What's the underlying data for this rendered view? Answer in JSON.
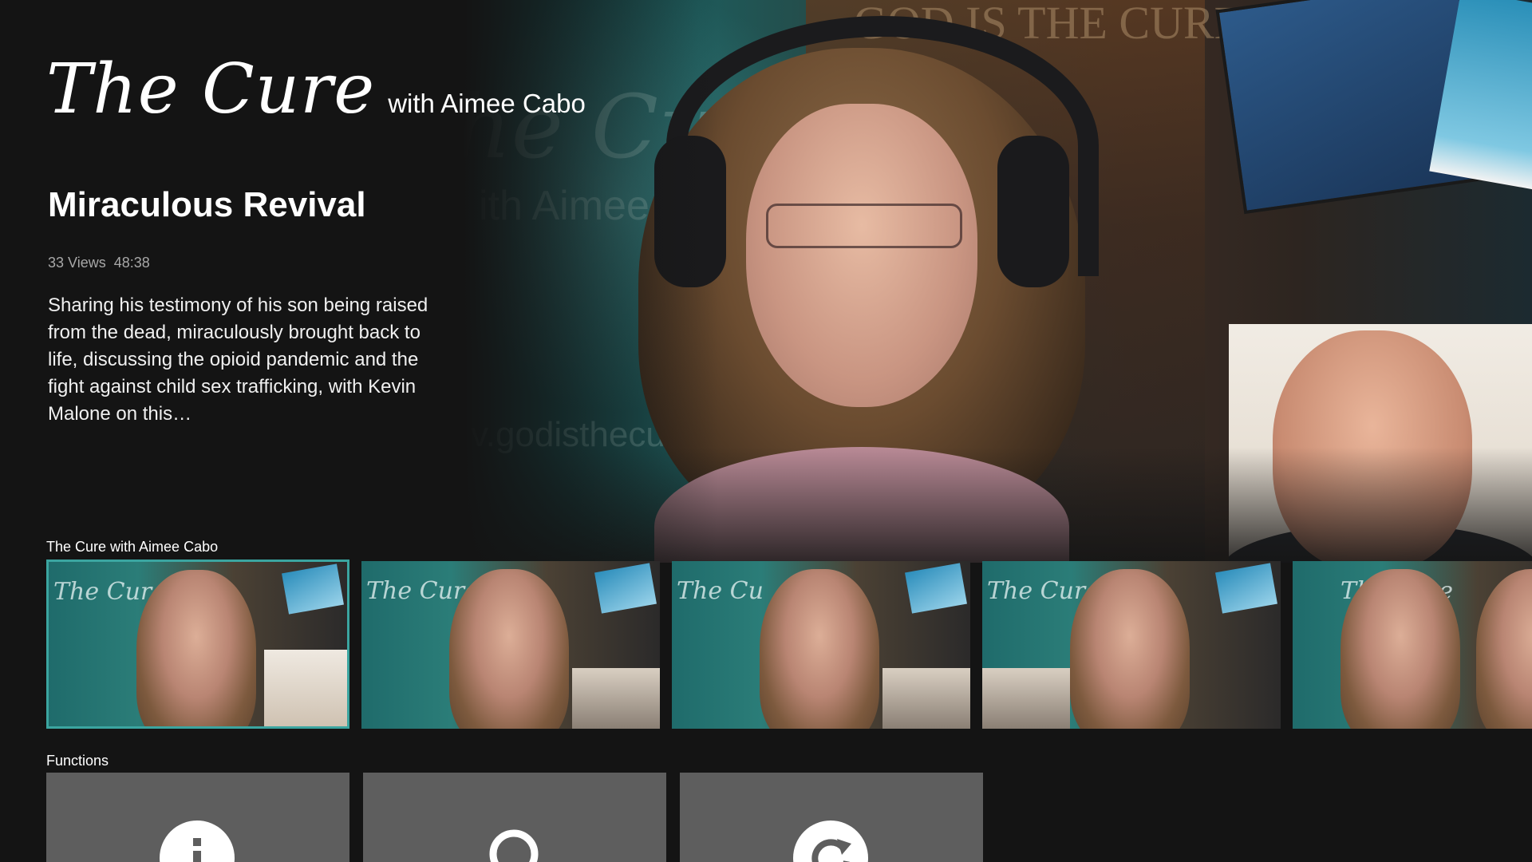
{
  "hero": {
    "logo_main": "The Cure",
    "logo_sub": "with Aimee Cabo",
    "title": "Miraculous Revival",
    "views": "33 Views",
    "duration": "48:38",
    "description": "Sharing his testimony of his son being raised from the dead, miraculously brought back to life, discussing the opioid pandemic and the fight against child sex trafficking, with Kevin Malone on this…",
    "art_text": {
      "bg_title": "he Cure",
      "bg_sub": "ith Aimee Cabo",
      "bg_url": "v.godisthecure",
      "bg_top": "GOD IS THE CURE"
    }
  },
  "episodes_row": {
    "label": "The Cure with Aimee Cabo",
    "items": [
      {
        "title_art": "The Cur",
        "selected": true
      },
      {
        "title_art": "The Cure",
        "selected": false
      },
      {
        "title_art": "The Cu",
        "selected": false
      },
      {
        "title_art": "The Cure",
        "selected": false
      },
      {
        "title_art": "The Cure",
        "selected": false
      }
    ]
  },
  "functions_row": {
    "label": "Functions",
    "items": [
      {
        "icon": "info-icon"
      },
      {
        "icon": "search-icon"
      },
      {
        "icon": "refresh-icon"
      }
    ]
  },
  "colors": {
    "background": "#141414",
    "selection_border": "#3ba5a0",
    "function_tile": "#5e5e5e",
    "meta_text": "#a8a8a8"
  }
}
